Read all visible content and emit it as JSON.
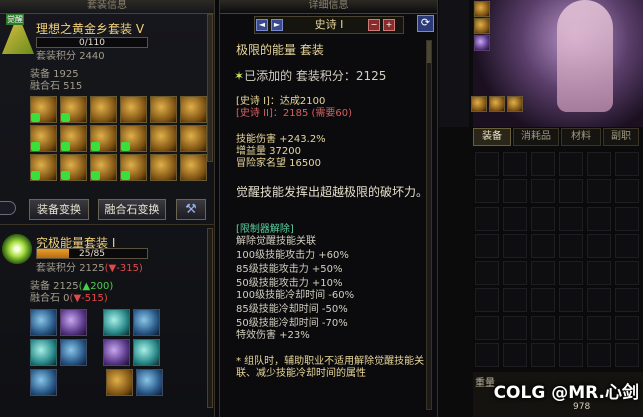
{
  "left": {
    "header": "套装信息",
    "set1": {
      "badge": "觉醒",
      "title": "理想之黄金乡套装 V",
      "progress_text": "0/110",
      "progress_pct": 0,
      "score_label": "套装积分",
      "score_value": "2440",
      "equip_line": "装备    1925",
      "stone_line": "融合石 515"
    },
    "buttons": {
      "equip_change": "装备变换",
      "stone_change": "融合石变换",
      "wrench": "wrench-icon"
    },
    "set2": {
      "title": "究极能量套装 I",
      "progress_text": "25/85",
      "progress_pct": 29.4,
      "score_label": "套装积分",
      "score_value": "2125",
      "score_delta": "(▼-315)",
      "equip_label": "装备    2125",
      "equip_delta": "(▲200)",
      "stone_label": "融合石 0",
      "stone_delta": "(▼-515)"
    }
  },
  "middle": {
    "header": "详细信息",
    "nav_title": "史诗 I",
    "nav_prev": "◄",
    "nav_next": "►",
    "nav_minus": "−",
    "nav_plus": "+",
    "refresh_icon": "refresh-icon",
    "set_name": "极限的能量  套装",
    "added_score": "已添加的  套装积分：2125",
    "epic1": "[史诗 I]：达成2100",
    "epic2": "[史诗 II]：2185 (需要60)",
    "stats": [
      "技能伤害 +243.2%",
      "增益量 37200",
      "冒险家名望 16500"
    ],
    "awaken_desc": "觉醒技能发挥出超越极限的破坏力。",
    "limit_title": "[限制器解除]",
    "limit_lines": [
      "解除觉醒技能关联",
      "100级技能攻击力 +60%",
      "85级技能攻击力 +50%",
      "50级技能攻击力 +10%",
      "100级技能冷却时间 -60%",
      "85级技能冷却时间 -50%",
      "50级技能冷却时间 -70%",
      "特效伤害 +23%"
    ],
    "note": "* 组队时，辅助职业不适用解除觉醒技能关联、减少技能冷却时间的属性"
  },
  "right": {
    "tabs": [
      "装备",
      "消耗品",
      "材料",
      "副职"
    ],
    "weight_label": "重量",
    "weight_value": "978",
    "watermark": "COLG @MR.心剑"
  }
}
